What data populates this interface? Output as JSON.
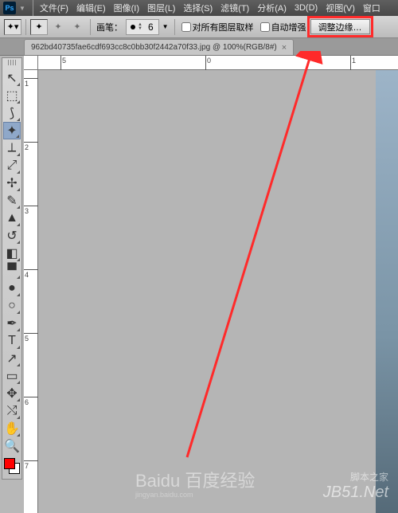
{
  "app": {
    "logo": "Ps"
  },
  "menu": [
    "文件(F)",
    "编辑(E)",
    "图像(I)",
    "图层(L)",
    "选择(S)",
    "滤镜(T)",
    "分析(A)",
    "3D(D)",
    "视图(V)",
    "窗口"
  ],
  "options": {
    "brush_label": "画笔：",
    "brush_size": "6",
    "sample_all_label": "对所有图层取样",
    "auto_enhance_label": "自动增强",
    "refine_edge_label": "调整边缘…"
  },
  "tab": {
    "title": "962bd40735fae6cdf693cc8c0bb30f2442a70f33.jpg @ 100%(RGB/8#)",
    "close": "×"
  },
  "ruler_h": [
    {
      "pos": 28,
      "label": "5"
    },
    {
      "pos": 210,
      "label": "0"
    },
    {
      "pos": 392,
      "label": "1"
    }
  ],
  "ruler_v": [
    {
      "pos": 10,
      "label": "1"
    },
    {
      "pos": 90,
      "label": "2"
    },
    {
      "pos": 170,
      "label": "3"
    },
    {
      "pos": 250,
      "label": "4"
    },
    {
      "pos": 330,
      "label": "5"
    },
    {
      "pos": 410,
      "label": "6"
    },
    {
      "pos": 490,
      "label": "7"
    }
  ],
  "tools": [
    {
      "name": "move-tool",
      "glyph": "↖",
      "tri": true
    },
    {
      "name": "marquee-tool",
      "glyph": "⬚",
      "tri": true
    },
    {
      "name": "lasso-tool",
      "glyph": "⟆",
      "tri": true
    },
    {
      "name": "quick-select-tool",
      "glyph": "✦",
      "tri": true,
      "active": true
    },
    {
      "name": "crop-tool",
      "glyph": "⟂",
      "tri": true
    },
    {
      "name": "eyedropper-tool",
      "glyph": "⤢",
      "tri": true
    },
    {
      "name": "spot-heal-tool",
      "glyph": "✢",
      "tri": true
    },
    {
      "name": "brush-tool",
      "glyph": "✎",
      "tri": true
    },
    {
      "name": "clone-stamp-tool",
      "glyph": "▲",
      "tri": true
    },
    {
      "name": "history-brush-tool",
      "glyph": "↺",
      "tri": true
    },
    {
      "name": "eraser-tool",
      "glyph": "◧",
      "tri": true
    },
    {
      "name": "gradient-tool",
      "glyph": "▀",
      "tri": true
    },
    {
      "name": "blur-tool",
      "glyph": "●",
      "tri": true
    },
    {
      "name": "dodge-tool",
      "glyph": "○",
      "tri": true
    },
    {
      "name": "pen-tool",
      "glyph": "✒",
      "tri": true
    },
    {
      "name": "type-tool",
      "glyph": "T",
      "tri": true
    },
    {
      "name": "path-select-tool",
      "glyph": "↗",
      "tri": true
    },
    {
      "name": "shape-tool",
      "glyph": "▭",
      "tri": true
    },
    {
      "name": "3d-tool",
      "glyph": "✥",
      "tri": true
    },
    {
      "name": "3d-camera-tool",
      "glyph": "⤭",
      "tri": true
    },
    {
      "name": "hand-tool",
      "glyph": "✋",
      "tri": true
    },
    {
      "name": "zoom-tool",
      "glyph": "🔍",
      "tri": false
    }
  ],
  "swatch": {
    "fg": "#ff0000",
    "bg": "#ffffff"
  },
  "watermark": {
    "baidu": "Baidu 百度经验",
    "baidu_sub": "jingyan.baidu.com",
    "jb": "JB51.Net",
    "jb_cn": "脚本之家"
  }
}
